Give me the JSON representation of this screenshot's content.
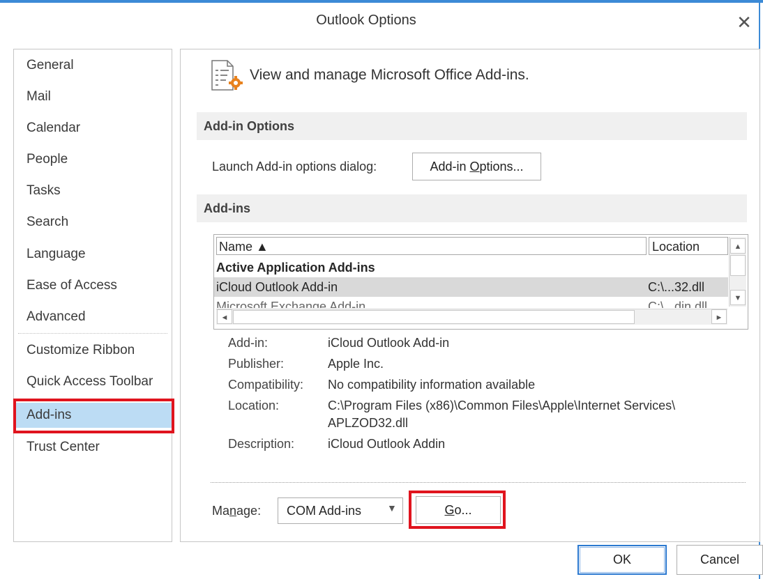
{
  "window": {
    "title": "Outlook Options",
    "close_glyph": "✕",
    "accent_color": "#3c8ad6",
    "highlight_color": "#e0141e"
  },
  "nav": {
    "items": [
      {
        "label": "General"
      },
      {
        "label": "Mail"
      },
      {
        "label": "Calendar"
      },
      {
        "label": "People"
      },
      {
        "label": "Tasks"
      },
      {
        "label": "Search"
      },
      {
        "label": "Language"
      },
      {
        "label": "Ease of Access"
      },
      {
        "label": "Advanced"
      },
      {
        "label": "Customize Ribbon"
      },
      {
        "label": "Quick Access Toolbar"
      },
      {
        "label": "Add-ins",
        "selected": true
      },
      {
        "label": "Trust Center"
      }
    ]
  },
  "main": {
    "heading": "View and manage Microsoft Office Add-ins.",
    "heading_icon": "document-gear-icon",
    "addin_options": {
      "section_title": "Add-in Options",
      "launch_label": "Launch Add-in options dialog:",
      "button_pre": "Add-in ",
      "button_key": "O",
      "button_post": "ptions..."
    },
    "addins": {
      "section_title": "Add-ins",
      "columns": {
        "name": "Name ▲",
        "location": "Location"
      },
      "rows": [
        {
          "name": "Active Application Add-ins",
          "location": "",
          "group": true
        },
        {
          "name": "iCloud Outlook Add-in",
          "location": "C:\\...32.dll",
          "selected": true
        },
        {
          "name": "Microsoft Exchange Add-in",
          "location": "C:\\...din.dll"
        }
      ]
    },
    "details": {
      "addin_label": "Add-in:",
      "addin_value": "iCloud Outlook Add-in",
      "publisher_label": "Publisher:",
      "publisher_value": "Apple Inc.",
      "compat_label": "Compatibility:",
      "compat_value": "No compatibility information available",
      "location_label": "Location:",
      "location_value_line1": "C:\\Program Files (x86)\\Common Files\\Apple\\Internet Services\\",
      "location_value_line2": "APLZOD32.dll",
      "description_label": "Description:",
      "description_value": "iCloud Outlook Addin"
    },
    "manage": {
      "label_pre": "Ma",
      "label_key": "n",
      "label_post": "age:",
      "selected": "COM Add-ins",
      "go_key": "G",
      "go_post": "o..."
    }
  },
  "footer": {
    "ok": "OK",
    "cancel": "Cancel"
  }
}
